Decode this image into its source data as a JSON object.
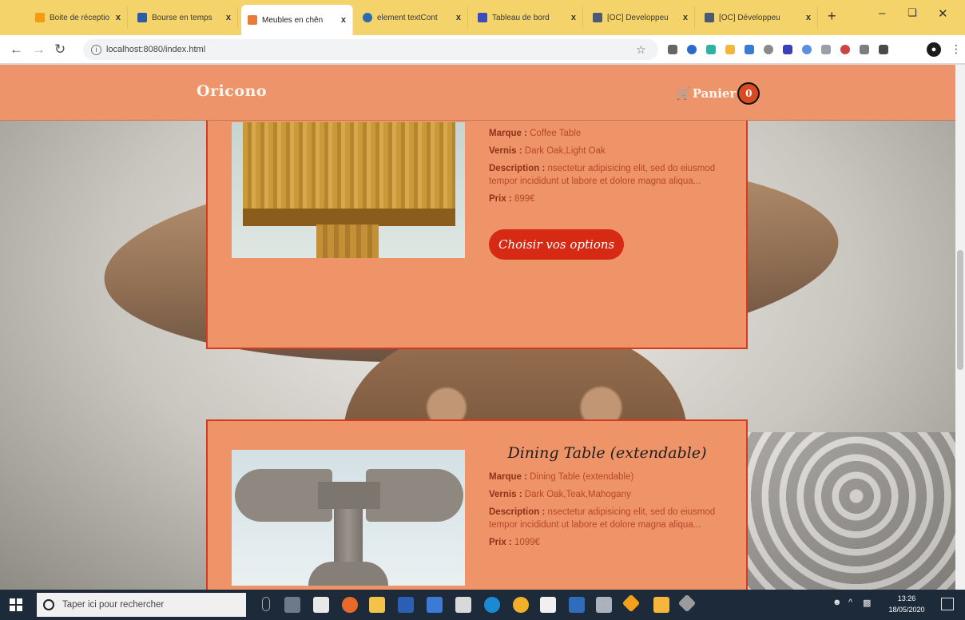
{
  "browser": {
    "tabs": [
      {
        "title": "Boite de réceptio",
        "favicon_color": "#f39c12"
      },
      {
        "title": "Bourse en temps",
        "favicon_color": "#2a5caa"
      },
      {
        "title": "Meubles en chên",
        "favicon_color": "#e77b3a",
        "active": true
      },
      {
        "title": "element textCont",
        "favicon_color": "#2b6cb0"
      },
      {
        "title": "Tableau de bord",
        "favicon_color": "#3b4ac0"
      },
      {
        "title": "[OC] Developpeu",
        "favicon_color": "#4a5a73"
      },
      {
        "title": "[OC] Développeu",
        "favicon_color": "#4a5a73"
      }
    ],
    "close_glyph": "x",
    "new_tab_glyph": "+",
    "url": "localhost:8080/index.html"
  },
  "header": {
    "brand": "Oricono",
    "cart_label": "Panier",
    "cart_count": "0"
  },
  "products": [
    {
      "title": "",
      "brand_label": "Marque :",
      "brand_value": "Coffee Table",
      "varnish_label": "Vernis :",
      "varnish_value": "Dark Oak,Light Oak",
      "description_label": "Description :",
      "description_value": "nsectetur adipisicing elit, sed do eiusmod tempor incididunt ut labore et dolore magna aliqua...",
      "price_label": "Prix :",
      "price_value": "899€",
      "button_label": "Choisir vos options"
    },
    {
      "title": "Dining Table (extendable)",
      "brand_label": "Marque :",
      "brand_value": "Dining Table (extendable)",
      "varnish_label": "Vernis :",
      "varnish_value": "Dark Oak,Teak,Mahogany",
      "description_label": "Description :",
      "description_value": "nsectetur adipisicing elit, sed do eiusmod tempor incididunt ut labore et dolore magna aliqua...",
      "price_label": "Prix :",
      "price_value": "1099€"
    }
  ],
  "taskbar": {
    "search_placeholder": "Taper ici pour rechercher",
    "time": "13:26",
    "date": "18/05/2020"
  },
  "colors": {
    "header": "#ee946a",
    "card": "#ee9468",
    "card_border": "#d63a1e",
    "button": "#d62a14"
  }
}
